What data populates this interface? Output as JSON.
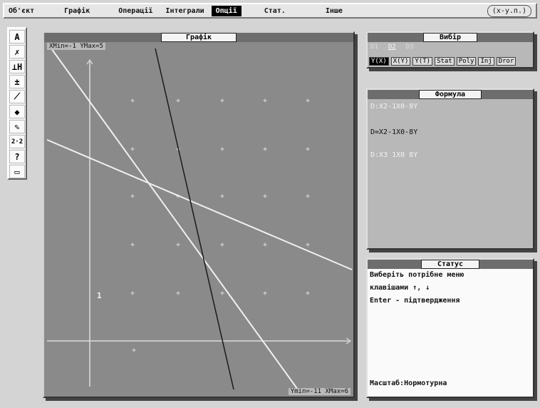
{
  "menu": {
    "items": [
      "Об'єкт",
      "Графік",
      "Операції",
      "Інтеграли",
      "Опції",
      "Стат.",
      "Інше"
    ],
    "active_index": 4,
    "outlined": "(х-у.п.)"
  },
  "toolbar": {
    "tools": [
      {
        "glyph": "A",
        "icon": "text-tool-icon"
      },
      {
        "glyph": "✗",
        "icon": "point-tool-icon"
      },
      {
        "glyph": "⊥H",
        "icon": "perpendicular-tool-icon"
      },
      {
        "glyph": "±",
        "icon": "axis-tool-icon"
      },
      {
        "glyph": "⟋",
        "icon": "angle-tool-icon"
      },
      {
        "glyph": "◆",
        "icon": "fill-tool-icon"
      },
      {
        "glyph": "✎",
        "icon": "pencil-tool-icon"
      },
      {
        "glyph": "2·2",
        "icon": "scale-tool-icon"
      },
      {
        "glyph": "?",
        "icon": "help-icon"
      },
      {
        "glyph": "▭",
        "icon": "keyboard-icon"
      }
    ]
  },
  "graph_window": {
    "title": "Графік",
    "top_readout": "ХMin=-1  YMax=5",
    "bottom_readout": "Ymin=-11  XMax=6"
  },
  "choice_panel": {
    "title": "Вибір",
    "tabs": [
      "D1",
      "D2",
      "D3"
    ],
    "selected_tab": 1,
    "buttons": [
      "Y(X)",
      "X(Y)",
      "Y(T)",
      "Stat",
      "Poly",
      "Inj",
      "Dror"
    ],
    "active_button": 0
  },
  "formula_panel": {
    "title": "Формула",
    "lines": [
      {
        "text": "D:X2-1X0-8Y",
        "color": "#f2f2f2"
      },
      {
        "text": "D=X2-1X0-8Y",
        "color": "#111111"
      },
      {
        "text": "D:X3 1X0 8Y",
        "color": "#f2f2f2"
      }
    ]
  },
  "status_panel": {
    "title": "Статус",
    "lines": [
      "Виберіть потрібне меню",
      "клавішами ↑, ↓",
      "Enter - підтвердження"
    ],
    "footer": "Масштаб:Нормотурна"
  },
  "colors": {
    "plot_bg": "#8a8a8a",
    "line_white": "#f0f0f0",
    "line_dark": "#1a1a1a",
    "axis": "#dcdcdc"
  }
}
